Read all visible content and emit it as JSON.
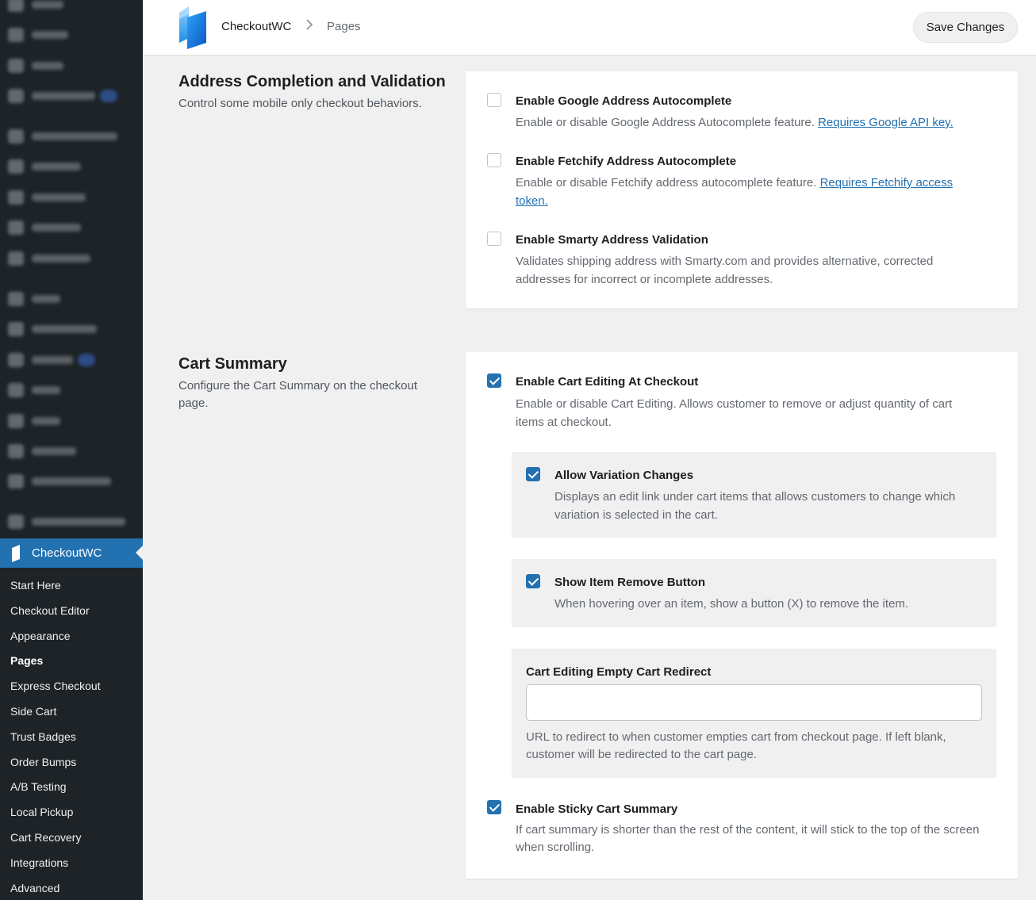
{
  "sidebar": {
    "active_label": "CheckoutWC",
    "submenu": [
      {
        "label": "Start Here",
        "current": false
      },
      {
        "label": "Checkout Editor",
        "current": false
      },
      {
        "label": "Appearance",
        "current": false
      },
      {
        "label": "Pages",
        "current": true
      },
      {
        "label": "Express Checkout",
        "current": false
      },
      {
        "label": "Side Cart",
        "current": false
      },
      {
        "label": "Trust Badges",
        "current": false
      },
      {
        "label": "Order Bumps",
        "current": false
      },
      {
        "label": "A/B Testing",
        "current": false
      },
      {
        "label": "Local Pickup",
        "current": false
      },
      {
        "label": "Cart Recovery",
        "current": false
      },
      {
        "label": "Integrations",
        "current": false
      },
      {
        "label": "Advanced",
        "current": false
      }
    ]
  },
  "header": {
    "brand": "CheckoutWC",
    "separator": ">",
    "page": "Pages",
    "save_label": "Save Changes"
  },
  "sections": {
    "address": {
      "title": "Address Completion and Validation",
      "description": "Control some mobile only checkout behaviors.",
      "options": {
        "google": {
          "label": "Enable Google Address Autocomplete",
          "checked": false,
          "desc": "Enable or disable Google Address Autocomplete feature.",
          "link": "Requires Google API key."
        },
        "fetchify": {
          "label": "Enable Fetchify Address Autocomplete",
          "checked": false,
          "desc": "Enable or disable Fetchify address autocomplete feature.",
          "link": "Requires Fetchify access token."
        },
        "smarty": {
          "label": "Enable Smarty Address Validation",
          "checked": false,
          "desc": "Validates shipping address with Smarty.com and provides alternative, corrected addresses for incorrect or incomplete addresses."
        }
      }
    },
    "cart": {
      "title": "Cart Summary",
      "description": "Configure the Cart Summary on the checkout page.",
      "options": {
        "editing": {
          "label": "Enable Cart Editing At Checkout",
          "checked": true,
          "desc": "Enable or disable Cart Editing. Allows customer to remove or adjust quantity of cart items at checkout."
        },
        "variation": {
          "label": "Allow Variation Changes",
          "checked": true,
          "desc": "Displays an edit link under cart items that allows customers to change which variation is selected in the cart."
        },
        "remove": {
          "label": "Show Item Remove Button",
          "checked": true,
          "desc": "When hovering over an item, show a button (X) to remove the item."
        },
        "redirect": {
          "label": "Cart Editing Empty Cart Redirect",
          "value": "",
          "desc": "URL to redirect to when customer empties cart from checkout page. If left blank, customer will be redirected to the cart page."
        },
        "sticky": {
          "label": "Enable Sticky Cart Summary",
          "checked": true,
          "desc": "If cart summary is shorter than the rest of the content, it will stick to the top of the screen when scrolling."
        }
      }
    }
  },
  "colors": {
    "accent": "#2271b1",
    "sidebar_bg": "#1d2327",
    "page_bg": "#f0f0f1"
  }
}
